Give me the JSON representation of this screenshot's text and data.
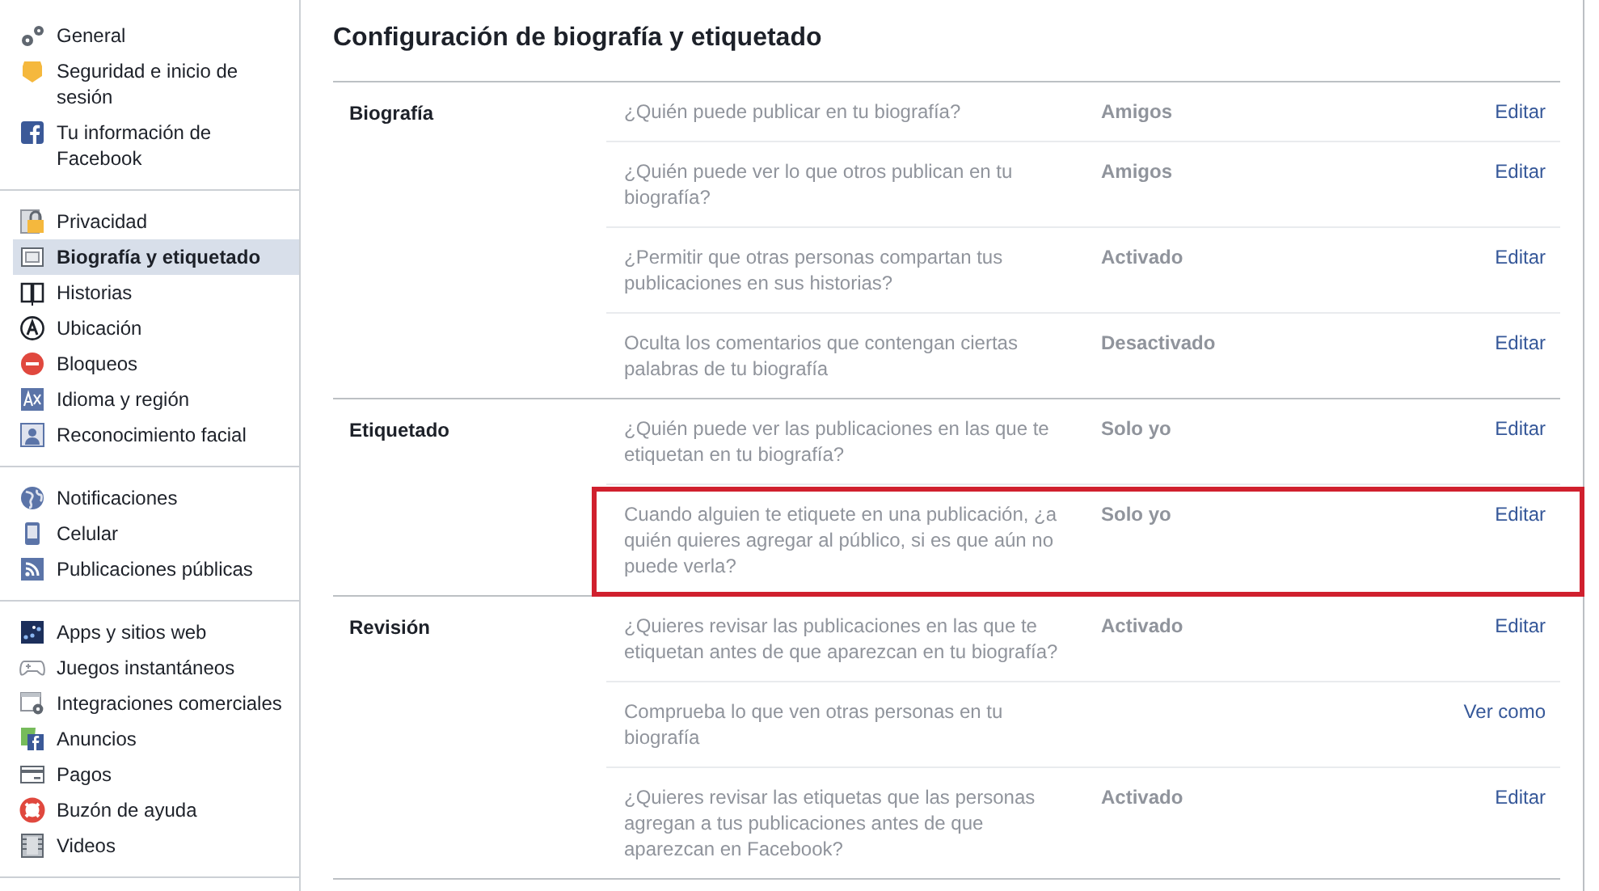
{
  "sidebar": {
    "groups": [
      {
        "items": [
          {
            "label": "General",
            "selected": false
          },
          {
            "label": "Seguridad e inicio de sesión",
            "selected": false
          },
          {
            "label": "Tu información de Facebook",
            "selected": false
          }
        ]
      },
      {
        "items": [
          {
            "label": "Privacidad",
            "selected": false
          },
          {
            "label": "Biografía y etiquetado",
            "selected": true
          },
          {
            "label": "Historias",
            "selected": false
          },
          {
            "label": "Ubicación",
            "selected": false
          },
          {
            "label": "Bloqueos",
            "selected": false
          },
          {
            "label": "Idioma y región",
            "selected": false
          },
          {
            "label": "Reconocimiento facial",
            "selected": false
          }
        ]
      },
      {
        "items": [
          {
            "label": "Notificaciones",
            "selected": false
          },
          {
            "label": "Celular",
            "selected": false
          },
          {
            "label": "Publicaciones públicas",
            "selected": false
          }
        ]
      },
      {
        "items": [
          {
            "label": "Apps y sitios web",
            "selected": false
          },
          {
            "label": "Juegos instantáneos",
            "selected": false
          },
          {
            "label": "Integraciones comerciales",
            "selected": false
          },
          {
            "label": "Anuncios",
            "selected": false
          },
          {
            "label": "Pagos",
            "selected": false
          },
          {
            "label": "Buzón de ayuda",
            "selected": false
          },
          {
            "label": "Videos",
            "selected": false
          }
        ]
      }
    ]
  },
  "page_title": "Configuración de biografía y etiquetado",
  "sections": [
    {
      "label": "Biografía",
      "rows": [
        {
          "question": "¿Quién puede publicar en tu biografía?",
          "value": "Amigos",
          "action": "Editar",
          "highlighted": false
        },
        {
          "question": "¿Quién puede ver lo que otros publican en tu biografía?",
          "value": "Amigos",
          "action": "Editar",
          "highlighted": false
        },
        {
          "question": "¿Permitir que otras personas compartan tus publicaciones en sus historias?",
          "value": "Activado",
          "action": "Editar",
          "highlighted": false
        },
        {
          "question": "Oculta los comentarios que contengan ciertas palabras de tu biografía",
          "value": "Desactivado",
          "action": "Editar",
          "highlighted": false
        }
      ]
    },
    {
      "label": "Etiquetado",
      "rows": [
        {
          "question": "¿Quién puede ver las publicaciones en las que te etiquetan en tu biografía?",
          "value": "Solo yo",
          "action": "Editar",
          "highlighted": false
        },
        {
          "question": "Cuando alguien te etiquete en una publicación, ¿a quién quieres agregar al público, si es que aún no puede verla?",
          "value": "Solo yo",
          "action": "Editar",
          "highlighted": true
        }
      ]
    },
    {
      "label": "Revisión",
      "rows": [
        {
          "question": "¿Quieres revisar las publicaciones en las que te etiquetan antes de que aparezcan en tu biografía?",
          "value": "Activado",
          "action": "Editar",
          "highlighted": false
        },
        {
          "question": "Comprueba lo que ven otras personas en tu biografía",
          "action": "Ver como",
          "highlighted": false
        },
        {
          "question": "¿Quieres revisar las etiquetas que las personas agregan a tus publicaciones antes de que aparezcan en Facebook?",
          "value": "Activado",
          "action": "Editar",
          "highlighted": false
        }
      ]
    }
  ]
}
